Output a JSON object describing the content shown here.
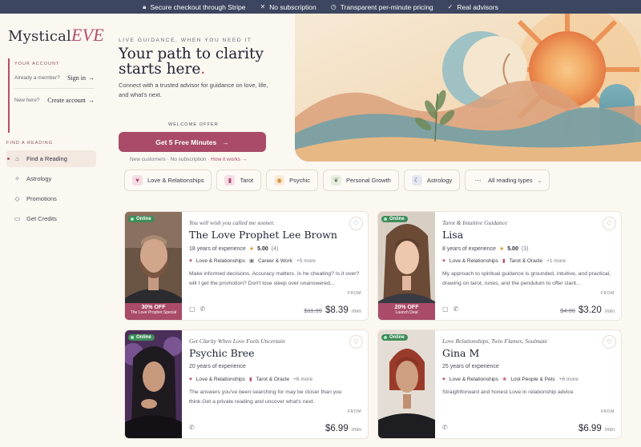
{
  "topbar": [
    {
      "icon": "lock-icon",
      "text": "Secure checkout through Stripe"
    },
    {
      "icon": "x-icon",
      "text": "No subscription"
    },
    {
      "icon": "clock-icon",
      "text": "Transparent per-minute pricing"
    },
    {
      "icon": "check-icon",
      "text": "Real advisors"
    }
  ],
  "brand": {
    "name": "Mystical",
    "accent": "EVE"
  },
  "account": {
    "label": "YOUR ACCOUNT",
    "member_prompt": "Already a member?",
    "sign_in": "Sign in",
    "new_prompt": "New here?",
    "create": "Create account"
  },
  "nav": {
    "label": "FIND A READING",
    "items": [
      {
        "label": "Find a Reading",
        "icon": "home-icon",
        "active": true
      },
      {
        "label": "Astrology",
        "icon": "sparkle-icon",
        "active": false
      },
      {
        "label": "Promotions",
        "icon": "tag-icon",
        "active": false
      },
      {
        "label": "Get Credits",
        "icon": "credit-card-icon",
        "active": false
      }
    ]
  },
  "hero": {
    "eyebrow": "LIVE GUIDANCE, WHEN YOU NEED IT",
    "headline_line1": "Your path to clarity",
    "headline_line2": "starts here",
    "headline_dot": ".",
    "subtitle": "Connect with a trusted advisor for guidance on love, life, and what's next.",
    "welcome": "WELCOME OFFER",
    "cta": "Get 5 Free Minutes",
    "note_1": "New customers · No subscription · ",
    "note_link": "How it works →"
  },
  "categories": [
    {
      "label": "Love & Relationships",
      "icon": "heart-icon"
    },
    {
      "label": "Tarot",
      "icon": "tarot-card-icon"
    },
    {
      "label": "Psychic",
      "icon": "eye-icon"
    },
    {
      "label": "Personal Growth",
      "icon": "leaf-icon"
    },
    {
      "label": "Astrology",
      "icon": "moon-icon"
    },
    {
      "label": "All reading types",
      "icon": "more-icon",
      "dropdown": true
    }
  ],
  "advisors": [
    {
      "status": "Online",
      "tagline": "You will wish you called me sooner.",
      "name": "The Love Prophet Lee Brown",
      "experience": "18 years of experience",
      "rating": "5.00",
      "reviews": "(4)",
      "cat1": "Love & Relationships",
      "cat2": "Career & Work",
      "more": "+5 more",
      "description": "Make informed decisions. Accuracy matters. Is he cheating? Is it over? will I get the promotion? Don't lose sleep over unanswered...",
      "promo_line1": "30% OFF",
      "promo_line2": "The Love Prophet Special",
      "from": "FROM",
      "old_price": "$11.99",
      "price": "$8.39",
      "unit": "/min"
    },
    {
      "status": "Online",
      "tagline": "Tarot & Intuitive Guidance",
      "name": "Lisa",
      "experience": "8 years of experience",
      "rating": "5.00",
      "reviews": "(3)",
      "cat1": "Love & Relationships",
      "cat2": "Tarot & Oracle",
      "more": "+1 more",
      "description": "My approach to spiritual guidance is grounded, intuitive, and practical, drawing on tarot, runes, and the pendulum to offer clarit...",
      "promo_line1": "20% OFF",
      "promo_line2": "Launch Deal",
      "from": "FROM",
      "old_price": "$4.00",
      "price": "$3.20",
      "unit": "/min"
    },
    {
      "status": "Online",
      "tagline": "Get Clarity When Love Feels Uncertain",
      "name": "Psychic Bree",
      "experience": "20 years of experience",
      "cat1": "Love & Relationships",
      "cat2": "Tarot & Oracle",
      "more": "+6 more",
      "description": "The answers you've been searching for may be closer than you think.Get a private reading and uncover what's next.",
      "from": "FROM",
      "price": "$6.99",
      "unit": "/min"
    },
    {
      "status": "Online",
      "tagline": "Love Relationships, Twin Flames, Soulmate",
      "name": "Gina M",
      "experience": "25 years of experience",
      "cat1": "Love & Relationships",
      "cat2": "Lost People & Pets",
      "more": "+6 more",
      "description": "Straightforward and honest Love in relationship advice",
      "from": "FROM",
      "price": "$6.99",
      "unit": "/min"
    }
  ],
  "colors": {
    "accent": "#a94b69",
    "topbar": "#3d4660",
    "online": "#3f8c5a",
    "background": "#fbf7f1"
  }
}
